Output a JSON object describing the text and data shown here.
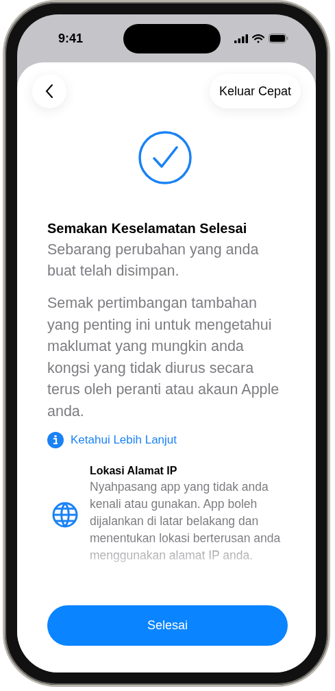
{
  "status_bar": {
    "time": "9:41"
  },
  "nav": {
    "quick_exit": "Keluar Cepat"
  },
  "title": "Semakan Keselamatan Selesai",
  "subtitle": "Sebarang perubahan yang anda buat telah disimpan.",
  "body": "Semak pertimbangan tambahan yang penting ini untuk mengetahui maklumat yang mungkin anda kongsi yang tidak diurus secara terus oleh peranti atau akaun Apple anda.",
  "link": "Ketahui Lebih Lanjut",
  "items": [
    {
      "kind": "globe",
      "title": "Lokasi Alamat IP",
      "description": "Nyahpasang app yang tidak anda kenali atau gunakan. App boleh dijalankan di latar belakang dan menentukan lokasi berterusan anda menggunakan alamat IP anda."
    }
  ],
  "done_button": "Selesai"
}
